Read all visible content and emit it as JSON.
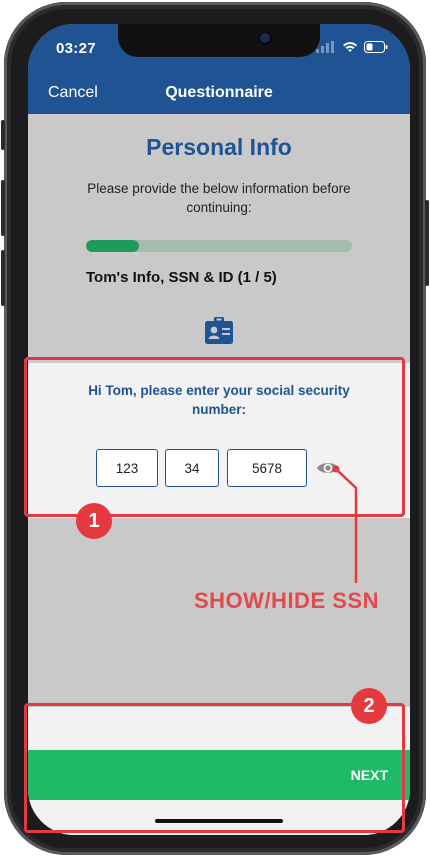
{
  "status_bar": {
    "time": "03:27"
  },
  "nav": {
    "cancel_label": "Cancel",
    "title": "Questionnaire"
  },
  "page": {
    "heading": "Personal Info",
    "subtitle": "Please provide the below information before continuing:",
    "progress_fraction": 0.2,
    "step_label": "Tom's Info, SSN & ID (1 / 5)"
  },
  "ssn_card": {
    "prompt": "Hi Tom, please enter your social security number:",
    "fields": [
      "123",
      "34",
      "5678"
    ]
  },
  "footer": {
    "next_label": "NEXT"
  },
  "annotations": {
    "badge_1": "1",
    "badge_2": "2",
    "eye_label": "SHOW/HIDE SSN"
  },
  "colors": {
    "brand_blue": "#1f5393",
    "progress_green": "#1f9a5a",
    "next_green": "#1fb968",
    "annotation_red": "#e53940"
  }
}
